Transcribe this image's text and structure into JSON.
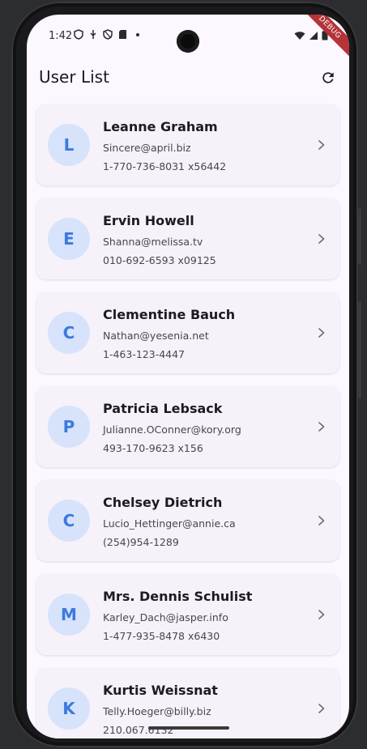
{
  "status_bar": {
    "time": "1:42"
  },
  "debug_label": "DEBUG",
  "app_bar": {
    "title": "User List"
  },
  "users": [
    {
      "initial": "L",
      "name": "Leanne Graham",
      "email": "Sincere@april.biz",
      "phone": "1-770-736-8031 x56442"
    },
    {
      "initial": "E",
      "name": "Ervin Howell",
      "email": "Shanna@melissa.tv",
      "phone": "010-692-6593 x09125"
    },
    {
      "initial": "C",
      "name": "Clementine Bauch",
      "email": "Nathan@yesenia.net",
      "phone": "1-463-123-4447"
    },
    {
      "initial": "P",
      "name": "Patricia Lebsack",
      "email": "Julianne.OConner@kory.org",
      "phone": "493-170-9623 x156"
    },
    {
      "initial": "C",
      "name": "Chelsey Dietrich",
      "email": "Lucio_Hettinger@annie.ca",
      "phone": "(254)954-1289"
    },
    {
      "initial": "M",
      "name": "Mrs. Dennis Schulist",
      "email": "Karley_Dach@jasper.info",
      "phone": "1-477-935-8478 x6430"
    },
    {
      "initial": "K",
      "name": "Kurtis Weissnat",
      "email": "Telly.Hoeger@billy.biz",
      "phone": "210.067.6132"
    }
  ],
  "colors": {
    "accent": "#3c79df",
    "avatar_bg": "#d6e3fb",
    "card_bg": "#f7f1fa",
    "screen_bg": "#fdf7ff"
  },
  "icons": {
    "refresh": "refresh-icon",
    "chevron": "chevron-right-icon"
  }
}
